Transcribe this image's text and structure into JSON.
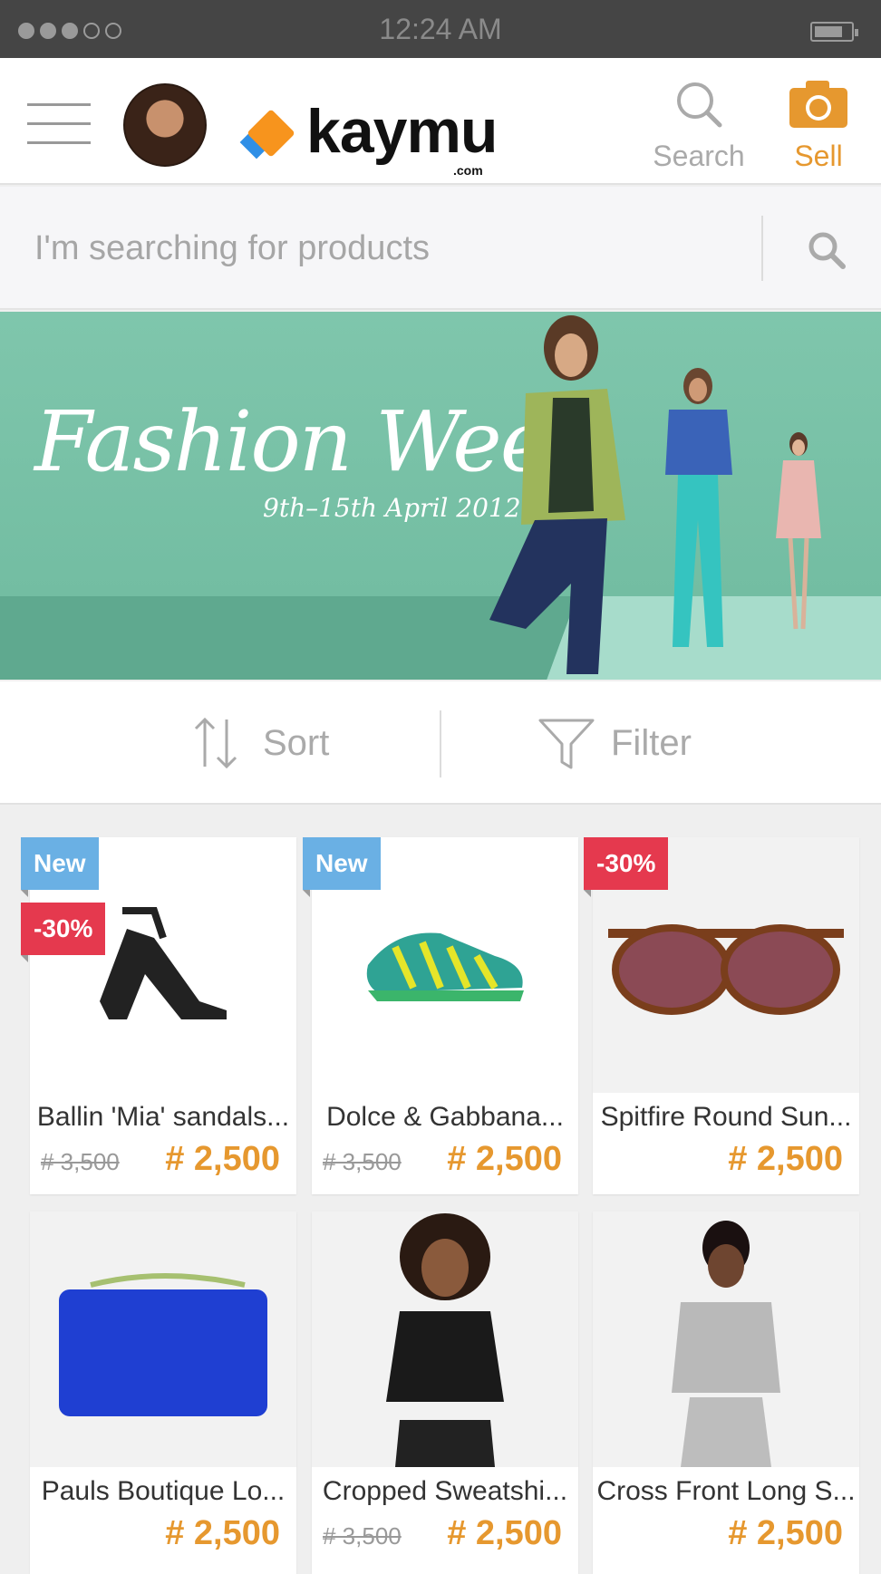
{
  "status": {
    "time": "12:24 AM"
  },
  "header": {
    "logo_text": "kaymu",
    "logo_sub": ".com",
    "search_label": "Search",
    "sell_label": "Sell"
  },
  "search": {
    "placeholder": "I'm searching for products"
  },
  "banner": {
    "title": "Fashion Week",
    "date": "9th–15th April 2012"
  },
  "toolbar": {
    "sort_label": "Sort",
    "filter_label": "Filter"
  },
  "colors": {
    "accent": "#e6982f",
    "new_badge": "#6ab0e4",
    "sale_badge": "#e5394e"
  },
  "products": [
    {
      "name": "Ballin 'Mia' sandals...",
      "old_price": "# 3,500",
      "price": "# 2,500",
      "badge_new": "New",
      "badge_sale": "-30%"
    },
    {
      "name": "Dolce & Gabbana...",
      "old_price": "# 3,500",
      "price": "# 2,500",
      "badge_new": "New"
    },
    {
      "name": "Spitfire Round Sun...",
      "price": "# 2,500",
      "badge_sale": "-30%"
    },
    {
      "name": "Pauls Boutique Lo...",
      "price": "# 2,500"
    },
    {
      "name": "Cropped Sweatshi...",
      "old_price": "# 3,500",
      "price": "# 2,500"
    },
    {
      "name": "Cross Front Long S...",
      "price": "# 2,500"
    }
  ]
}
